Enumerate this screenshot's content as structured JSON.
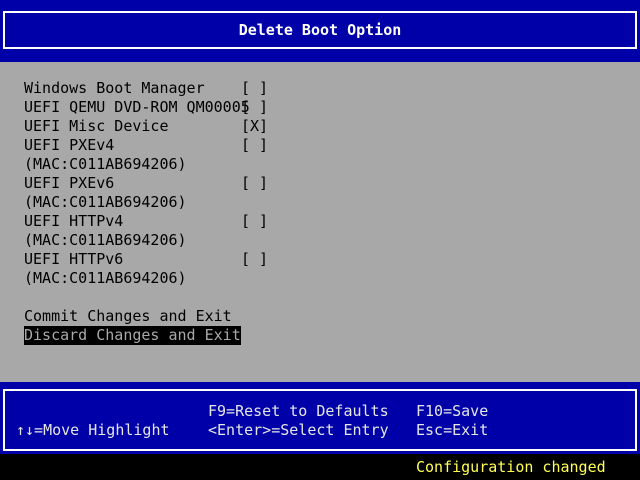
{
  "header": {
    "title": "Delete Boot Option"
  },
  "options": [
    {
      "label": "Windows Boot Manager",
      "check": "[ ]"
    },
    {
      "label": "UEFI QEMU DVD-ROM QM00005",
      "check": "[ ]"
    },
    {
      "label": "UEFI Misc Device",
      "check": "[X]"
    },
    {
      "label": "UEFI PXEv4",
      "sublabel": "(MAC:C011AB694206)",
      "check": "[ ]"
    },
    {
      "label": "UEFI PXEv6",
      "sublabel": "(MAC:C011AB694206)",
      "check": "[ ]"
    },
    {
      "label": "UEFI HTTPv4",
      "sublabel": "(MAC:C011AB694206)",
      "check": "[ ]"
    },
    {
      "label": "UEFI HTTPv6",
      "sublabel": "(MAC:C011AB694206)",
      "check": "[ ]"
    }
  ],
  "actions": {
    "commit": "Commit Changes and Exit",
    "discard": "Discard Changes and Exit"
  },
  "footer": {
    "move_highlight": "↑↓=Move Highlight",
    "reset_defaults": "F9=Reset to Defaults",
    "select_entry": "<Enter>=Select Entry",
    "save": "F10=Save",
    "exit": "Esc=Exit"
  },
  "status": "Configuration changed",
  "colors": {
    "bios_blue": "#0000a8",
    "panel_gray": "#a8a8a8",
    "status_yellow": "#ffff54",
    "highlight_bg": "#000000"
  }
}
